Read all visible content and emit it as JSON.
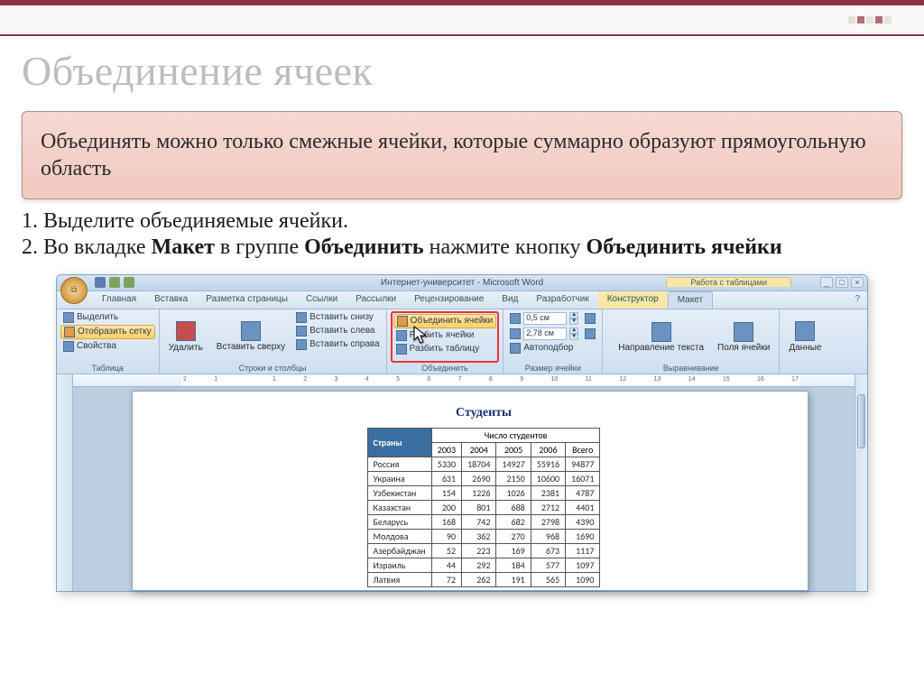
{
  "slide": {
    "title": "Объединение ячеек",
    "info_box": "Объединять можно только смежные ячейки, которые суммарно образуют прямоугольную область",
    "step1": "1. Выделите объединяемые ячейки.",
    "step2_pre": "2. Во вкладке ",
    "step2_b1": "Макет",
    "step2_mid": " в группе ",
    "step2_b2": "Объединить",
    "step2_post": " нажмите кнопку ",
    "step2_b3": "Объединить ячейки"
  },
  "word": {
    "window_title": "Интернет-университет - Microsoft Word",
    "tool_tab_title": "Работа с таблицами",
    "tabs": [
      "Главная",
      "Вставка",
      "Разметка страницы",
      "Ссылки",
      "Рассылки",
      "Рецензирование",
      "Вид",
      "Разработчик",
      "Конструктор",
      "Макет"
    ],
    "help_icon": "?",
    "groups": {
      "table": {
        "label": "Таблица",
        "select": "Выделить",
        "gridlines": "Отобразить сетку",
        "properties": "Свойства"
      },
      "rows_cols": {
        "label": "Строки и столбцы",
        "delete": "Удалить",
        "insert_above": "Вставить сверху",
        "insert_below": "Вставить снизу",
        "insert_left": "Вставить слева",
        "insert_right": "Вставить справа"
      },
      "merge": {
        "label": "Объединить",
        "merge_cells": "Объединить ячейки",
        "split_cells": "Разбить ячейки",
        "split_table": "Разбить таблицу"
      },
      "cell_size": {
        "label": "Размер ячейки",
        "height": "0,5 см",
        "width": "2,78 см",
        "autofit": "Автоподбор"
      },
      "alignment": {
        "label": "Выравнивание",
        "direction": "Направление текста",
        "margins": "Поля ячейки"
      },
      "data": {
        "label": "Данные"
      }
    },
    "ruler_marks": [
      "2",
      "1",
      "",
      "1",
      "2",
      "3",
      "4",
      "5",
      "6",
      "7",
      "8",
      "9",
      "10",
      "11",
      "12",
      "13",
      "14",
      "15",
      "16",
      "17"
    ]
  },
  "document": {
    "title": "Студенты",
    "header_country": "Страны",
    "header_merged": "Число студентов",
    "years": [
      "2003",
      "2004",
      "2005",
      "2006",
      "Всего"
    ],
    "rows": [
      {
        "country": "Россия",
        "v": [
          "5330",
          "18704",
          "14927",
          "55916",
          "94877"
        ]
      },
      {
        "country": "Украина",
        "v": [
          "631",
          "2690",
          "2150",
          "10600",
          "16071"
        ]
      },
      {
        "country": "Узбекистан",
        "v": [
          "154",
          "1226",
          "1026",
          "2381",
          "4787"
        ]
      },
      {
        "country": "Казахстан",
        "v": [
          "200",
          "801",
          "688",
          "2712",
          "4401"
        ]
      },
      {
        "country": "Беларусь",
        "v": [
          "168",
          "742",
          "682",
          "2798",
          "4390"
        ]
      },
      {
        "country": "Молдова",
        "v": [
          "90",
          "362",
          "270",
          "968",
          "1690"
        ]
      },
      {
        "country": "Азербайджан",
        "v": [
          "52",
          "223",
          "169",
          "673",
          "1117"
        ]
      },
      {
        "country": "Израиль",
        "v": [
          "44",
          "292",
          "184",
          "577",
          "1097"
        ]
      },
      {
        "country": "Латвия",
        "v": [
          "72",
          "262",
          "191",
          "565",
          "1090"
        ]
      }
    ]
  }
}
